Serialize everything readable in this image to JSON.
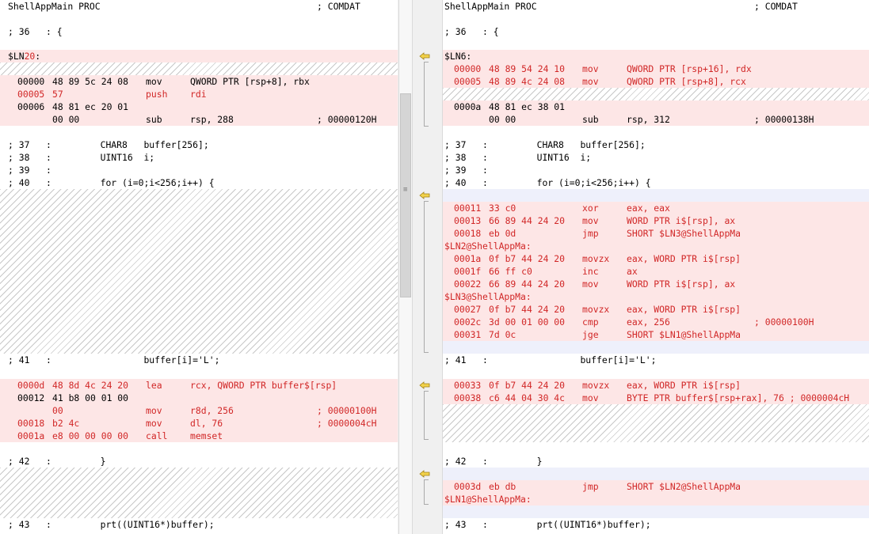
{
  "left": {
    "proc_name": "ShellAppMain PROC",
    "proc_comdat": "; COMDAT",
    "line36": "; 36   : {",
    "label_prefix": "$LN",
    "label_num": "20",
    "label_colon": ":",
    "asm1": [
      {
        "addr": "00000",
        "bytes": "48 89 5c 24 08",
        "op": "mov",
        "arg": "QWORD PTR [rsp+8], rbx",
        "comment": ""
      },
      {
        "addr": "00005",
        "bytes": "57",
        "op": "push",
        "arg": "rdi",
        "comment": ""
      },
      {
        "addr": "00006",
        "bytes": "48 81 ec 20 01",
        "op": "",
        "arg": "",
        "comment": ""
      },
      {
        "addr": "",
        "bytes": "00 00",
        "op": "sub",
        "arg": "rsp, 288",
        "comment": "; 00000120H"
      }
    ],
    "src_lines": [
      "; 37   :         CHAR8   buffer[256];",
      "; 38   :         UINT16  i;",
      "; 39   :",
      "; 40   :         for (i=0;i<256;i++) {"
    ],
    "line41": "; 41   :                 buffer[i]='L';",
    "asm2": [
      {
        "addr": "0000d",
        "bytes": "48 8d 4c 24 20",
        "op": "lea",
        "arg": "rcx, QWORD PTR buffer$[rsp]",
        "comment": ""
      },
      {
        "addr": "00012",
        "bytes": "41 b8 00 01 00",
        "op": "",
        "arg": "",
        "comment": ""
      },
      {
        "addr": "",
        "bytes": "00",
        "op": "mov",
        "arg": "r8d, 256",
        "comment": "; 00000100H"
      },
      {
        "addr": "00018",
        "bytes": "b2 4c",
        "op": "mov",
        "arg": "dl, 76",
        "comment": "; 0000004cH"
      },
      {
        "addr": "0001a",
        "bytes": "e8 00 00 00 00",
        "op": "call",
        "arg": "memset",
        "comment": ""
      }
    ],
    "line42": "; 42   :         }",
    "line43": "; 43   :         prt((UINT16*)buffer);"
  },
  "right": {
    "proc_name": "ShellAppMain PROC",
    "proc_comdat": "; COMDAT",
    "line36": "; 36   : {",
    "label": "$LN6:",
    "asm1": [
      {
        "addr": "00000",
        "bytes": "48 89 54 24 10",
        "op": "mov",
        "arg": "QWORD PTR [rsp+16], rdx",
        "comment": ""
      },
      {
        "addr": "00005",
        "bytes": "48 89 4c 24 08",
        "op": "mov",
        "arg": "QWORD PTR [rsp+8], rcx",
        "comment": ""
      }
    ],
    "asm1b": [
      {
        "addr": "0000a",
        "bytes": "48 81 ec 38 01",
        "op": "",
        "arg": "",
        "comment": ""
      },
      {
        "addr": "",
        "bytes": "00 00",
        "op": "sub",
        "arg": "rsp, 312",
        "comment": "; 00000138H"
      }
    ],
    "src_lines": [
      "; 37   :         CHAR8   buffer[256];",
      "; 38   :         UINT16  i;",
      "; 39   :",
      "; 40   :         for (i=0;i<256;i++) {"
    ],
    "loop": [
      {
        "type": "asm",
        "addr": "00011",
        "bytes": "33 c0",
        "op": "xor",
        "arg": "eax, eax",
        "comment": ""
      },
      {
        "type": "asm",
        "addr": "00013",
        "bytes": "66 89 44 24 20",
        "op": "mov",
        "arg": "WORD PTR i$[rsp], ax",
        "comment": ""
      },
      {
        "type": "asm",
        "addr": "00018",
        "bytes": "eb 0d",
        "op": "jmp",
        "arg": "SHORT $LN3@ShellAppMa",
        "comment": ""
      },
      {
        "type": "label",
        "text": "$LN2@ShellAppMa:"
      },
      {
        "type": "asm",
        "addr": "0001a",
        "bytes": "0f b7 44 24 20",
        "op": "movzx",
        "arg": "eax, WORD PTR i$[rsp]",
        "comment": ""
      },
      {
        "type": "asm",
        "addr": "0001f",
        "bytes": "66 ff c0",
        "op": "inc",
        "arg": "ax",
        "comment": ""
      },
      {
        "type": "asm",
        "addr": "00022",
        "bytes": "66 89 44 24 20",
        "op": "mov",
        "arg": "WORD PTR i$[rsp], ax",
        "comment": ""
      },
      {
        "type": "label",
        "text": "$LN3@ShellAppMa:"
      },
      {
        "type": "asm",
        "addr": "00027",
        "bytes": "0f b7 44 24 20",
        "op": "movzx",
        "arg": "eax, WORD PTR i$[rsp]",
        "comment": ""
      },
      {
        "type": "asm",
        "addr": "0002c",
        "bytes": "3d 00 01 00 00",
        "op": "cmp",
        "arg": "eax, 256",
        "comment": "; 00000100H"
      },
      {
        "type": "asm",
        "addr": "00031",
        "bytes": "7d 0c",
        "op": "jge",
        "arg": "SHORT $LN1@ShellAppMa",
        "comment": ""
      }
    ],
    "line41": "; 41   :                 buffer[i]='L';",
    "asm2": [
      {
        "addr": "00033",
        "bytes": "0f b7 44 24 20",
        "op": "movzx",
        "arg": "eax, WORD PTR i$[rsp]",
        "comment": ""
      },
      {
        "addr": "00038",
        "bytes": "c6 44 04 30 4c",
        "op": "mov",
        "arg": "BYTE PTR buffer$[rsp+rax], 76 ; 0000004cH",
        "comment": ""
      }
    ],
    "line42": "; 42   :         }",
    "asm3": [
      {
        "addr": "0003d",
        "bytes": "eb db",
        "op": "jmp",
        "arg": "SHORT $LN2@ShellAppMa",
        "comment": ""
      }
    ],
    "label_ln1": "$LN1@ShellAppMa:",
    "line43": "; 43   :         prt((UINT16*)buffer);"
  },
  "colors": {
    "diff_bg": "#fde6e6",
    "changed_text": "#d12727",
    "hatch": "#c8c8c8",
    "blue_bg": "#eef0fb",
    "arrow": "#e8c840"
  },
  "icons": [
    "diff-arrow-icon",
    "scrollbar-grip-icon"
  ]
}
